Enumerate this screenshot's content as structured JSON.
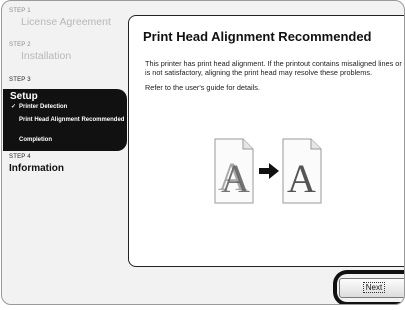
{
  "sidebar": {
    "steps": [
      {
        "label": "STEP 1",
        "title": "License Agreement"
      },
      {
        "label": "STEP 2",
        "title": "Installation"
      },
      {
        "label": "STEP 3",
        "title": "Setup"
      },
      {
        "label": "STEP 4",
        "title": "Information"
      }
    ],
    "substeps": [
      {
        "check": "✓",
        "label": "Printer Detection"
      },
      {
        "check": "",
        "label": "Print Head Alignment Recommended"
      },
      {
        "check": "",
        "label": "Completion"
      }
    ]
  },
  "main": {
    "title": "Print Head Alignment Recommended",
    "paragraph1": "This printer has print head alignment. If the printout contains misaligned lines or is not satisfactory, aligning the print head may resolve these problems.",
    "paragraph2": "Refer to the user's guide for details.",
    "illustration": {
      "before_letter": "A",
      "after_letter": "A"
    }
  },
  "footer": {
    "next_label": "Next"
  }
}
